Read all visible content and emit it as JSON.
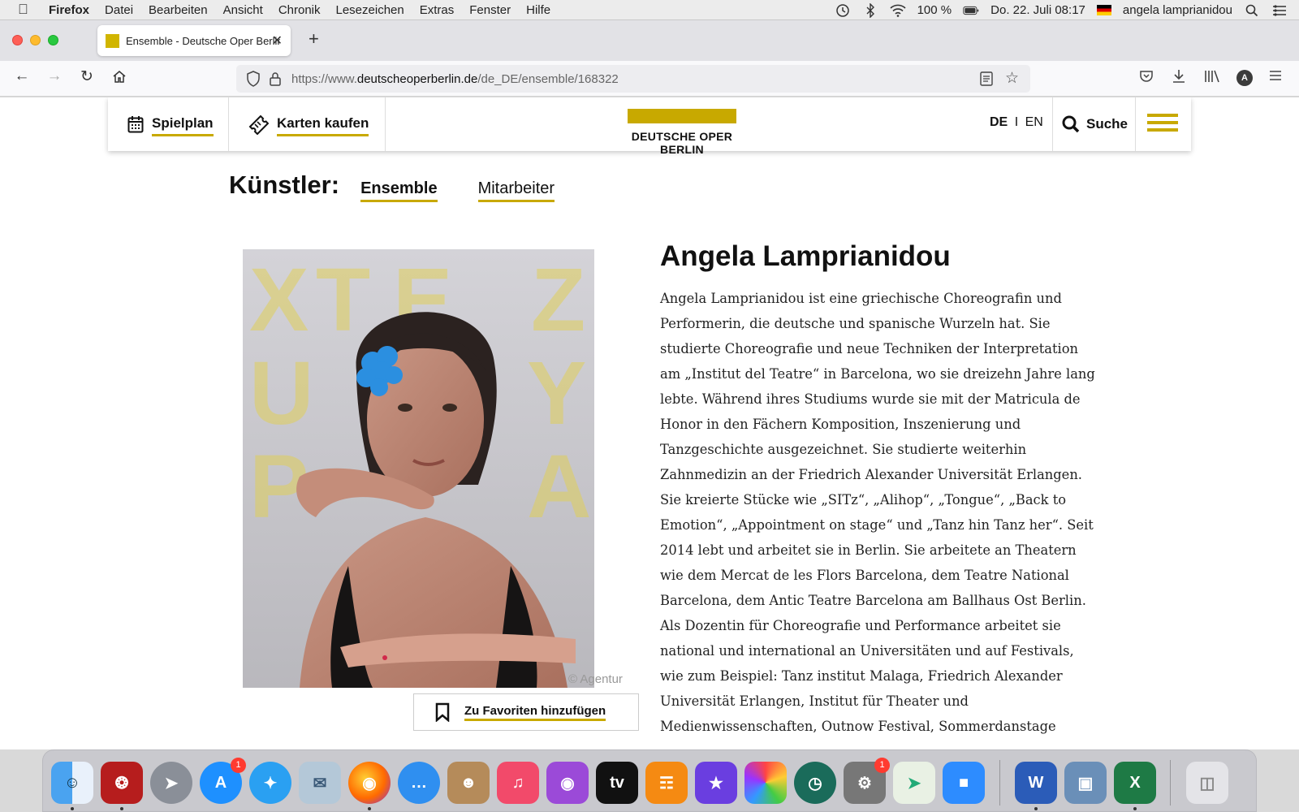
{
  "menubar": {
    "app_name": "Firefox",
    "menus": [
      "Datei",
      "Bearbeiten",
      "Ansicht",
      "Chronik",
      "Lesezeichen",
      "Extras",
      "Fenster",
      "Hilfe"
    ],
    "battery": "100 %",
    "datetime": "Do. 22. Juli  08:17",
    "user": "angela lamprianidou"
  },
  "browser": {
    "tab_title": "Ensemble - Deutsche Oper Berlin",
    "url_prefix": "https://www.",
    "url_domain": "deutscheoperberlin.de",
    "url_path": "/de_DE/ensemble/168322"
  },
  "site": {
    "spielplan": "Spielplan",
    "karten": "Karten kaufen",
    "logo_text": "DEUTSCHE OPER BERLIN",
    "lang_de": "DE",
    "lang_sep": "I",
    "lang_en": "EN",
    "search": "Suche",
    "brand_color": "#c8a900"
  },
  "subnav": {
    "heading": "Künstler:",
    "links": [
      "Ensemble",
      "Mitarbeiter"
    ],
    "active": "Ensemble"
  },
  "artist": {
    "name": "Angela Lamprianidou",
    "photo_credit": "© Agentur",
    "favorite_label": "Zu Favoriten hinzufügen",
    "bio": "Angela Lamprianidou ist eine griechische Choreografin und Performerin, die deutsche und spanische Wurzeln hat. Sie studierte Choreografie und neue Techniken der Interpretation am „Institut del Teatre“ in Barcelona, wo sie dreizehn Jahre lang lebte. Während ihres Studiums wurde sie mit der Matricula de Honor in den Fächern Komposition, Inszenierung und Tanzgeschichte ausgezeichnet. Sie studierte weiterhin Zahnmedizin an der Friedrich Alexander Universität Erlangen. Sie kreierte Stücke wie „SITz“, „Alihop“, „Tongue“, „Back to Emotion“, „Appointment on stage“ und „Tanz hin Tanz her“. Seit 2014 lebt und arbeitet sie in Berlin. Sie arbeitete an Theatern wie dem Mercat de les Flors Barcelona, dem Teatre National Barcelona, dem Antic Teatre Barcelona am Ballhaus Ost Berlin. Als Dozentin für Choreografie und Performance arbeitet sie national und international an Universitäten und auf Festivals, wie zum Beispiel: Tanz institut Malaga, Friedrich Alexander Universität Erlangen, Institut für Theater und Medienwissenschaften, Outnow Festival, Sommerdanstage"
  },
  "dock": {
    "badges": {
      "appstore": "1",
      "settings": "1"
    }
  }
}
